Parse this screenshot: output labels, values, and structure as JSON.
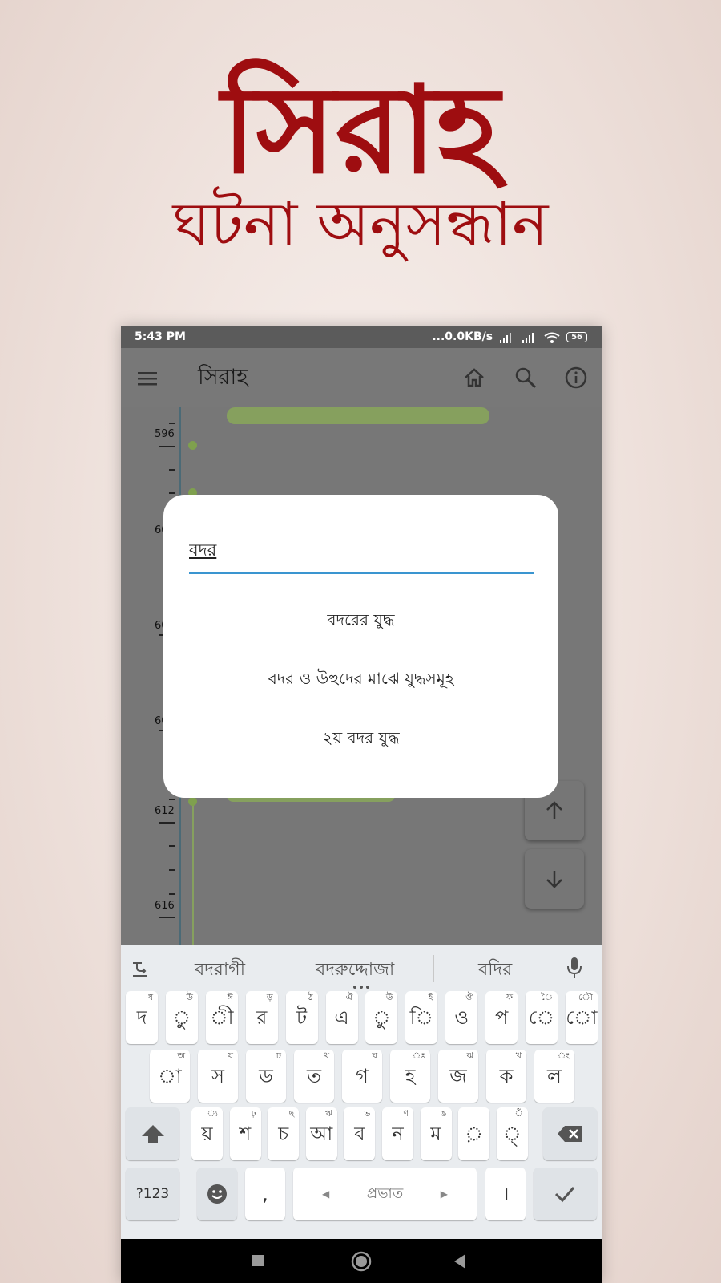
{
  "promo": {
    "title": "সিরাহ",
    "subtitle": "ঘটনা অনুসন্ধান"
  },
  "status_bar": {
    "time": "5:43 PM",
    "network": "...0.0KB/s",
    "battery": "56"
  },
  "app_bar": {
    "title": "সিরাহ",
    "icons": [
      "menu-icon",
      "home-icon",
      "search-icon",
      "info-icon"
    ]
  },
  "timeline": {
    "years": [
      "596",
      "60",
      "60",
      "60",
      "612",
      "616"
    ]
  },
  "search_dialog": {
    "query": "বদর",
    "results": [
      "বদরের যুদ্ধ",
      "বদর ও উহুদের মাঝে যুদ্ধসমূহ",
      "২য় বদর যুদ্ধ"
    ]
  },
  "keyboard": {
    "suggestions": [
      "বদরাগী",
      "বদরুদ্দোজা",
      "বদির"
    ],
    "row1": [
      {
        "label": "দ",
        "hint": "ধ"
      },
      {
        "label": "ু",
        "hint": "উ"
      },
      {
        "label": "ী",
        "hint": "ঈ"
      },
      {
        "label": "র",
        "hint": "ড়"
      },
      {
        "label": "ট",
        "hint": "ঠ"
      },
      {
        "label": "এ",
        "hint": "ঐ"
      },
      {
        "label": "ু",
        "hint": "উ"
      },
      {
        "label": "ি",
        "hint": "ই"
      },
      {
        "label": "ও",
        "hint": "ঔ"
      },
      {
        "label": "প",
        "hint": "ফ"
      },
      {
        "label": "ে",
        "hint": "ৈ"
      },
      {
        "label": "ো",
        "hint": "ৌ"
      }
    ],
    "row2": [
      {
        "label": "া",
        "hint": "অ"
      },
      {
        "label": "স",
        "hint": "য"
      },
      {
        "label": "ড",
        "hint": "ঢ"
      },
      {
        "label": "ত",
        "hint": "থ"
      },
      {
        "label": "গ",
        "hint": "ঘ"
      },
      {
        "label": "হ",
        "hint": "ঃ"
      },
      {
        "label": "জ",
        "hint": "ঝ"
      },
      {
        "label": "ক",
        "hint": "খ"
      },
      {
        "label": "ল",
        "hint": "ং"
      }
    ],
    "row3": [
      {
        "label": "য়",
        "hint": "্য"
      },
      {
        "label": "শ",
        "hint": "ঢ়"
      },
      {
        "label": "চ",
        "hint": "ছ"
      },
      {
        "label": "আ",
        "hint": "ঋ"
      },
      {
        "label": "ব",
        "hint": "ভ"
      },
      {
        "label": "ন",
        "hint": "ণ"
      },
      {
        "label": "ম",
        "hint": "ঙ"
      },
      {
        "label": "়",
        "hint": ""
      },
      {
        "label": "্",
        "hint": "ঁ"
      }
    ],
    "symbols_key": "?123",
    "comma_key": ",",
    "space_label": "প্রভাত",
    "danda_key": "।"
  }
}
